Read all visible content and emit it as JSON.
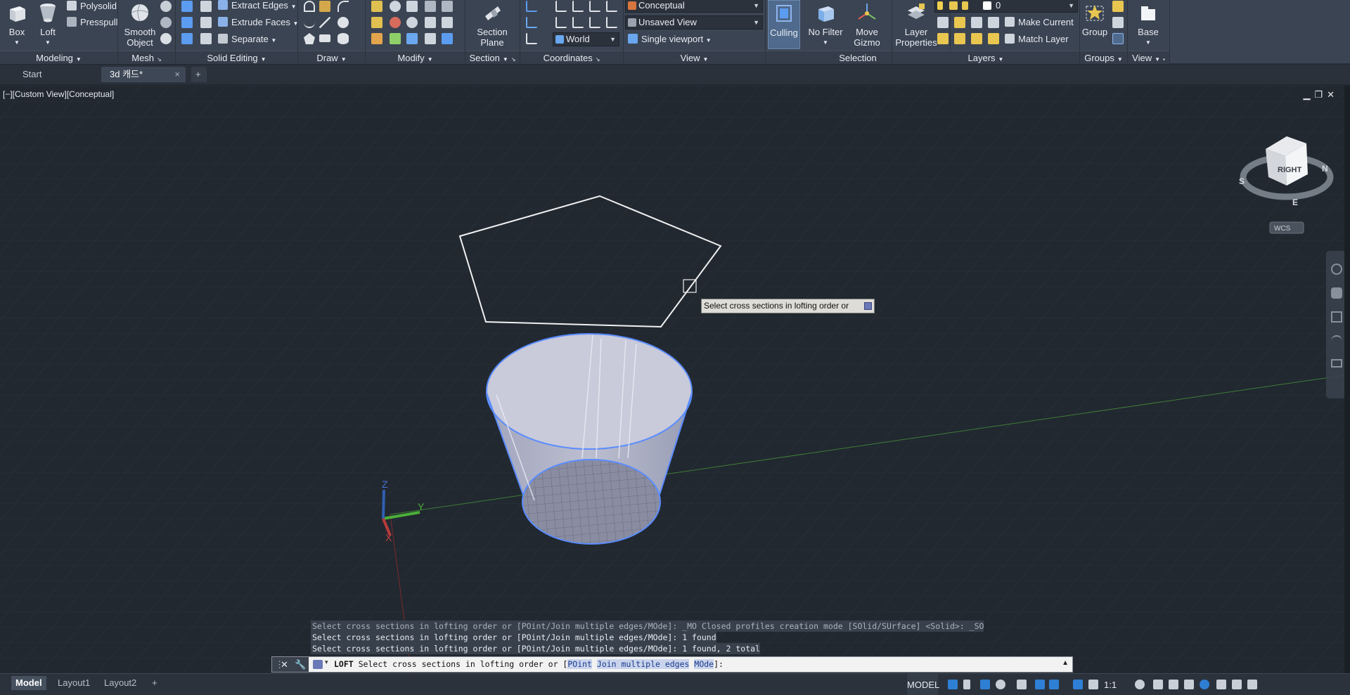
{
  "ribbon": {
    "modeling": {
      "title": "Modeling",
      "box": "Box",
      "loft": "Loft",
      "polysolid": "Polysolid",
      "presspull": "Presspull"
    },
    "mesh": {
      "title": "Mesh",
      "smooth_object": "Smooth Object"
    },
    "solid_editing": {
      "title": "Solid Editing",
      "extract_edges": "Extract Edges",
      "extrude_faces": "Extrude Faces",
      "separate": "Separate"
    },
    "draw": {
      "title": "Draw"
    },
    "modify": {
      "title": "Modify"
    },
    "section": {
      "title": "Section",
      "section_plane": "Section Plane"
    },
    "coordinates": {
      "title": "Coordinates",
      "world": "World"
    },
    "view": {
      "title": "View",
      "visual_style": "Conceptual",
      "named_view": "Unsaved View",
      "viewport": "Single viewport"
    },
    "selection": {
      "title": "Selection",
      "culling": "Culling",
      "no_filter": "No Filter",
      "move_gizmo": "Move Gizmo"
    },
    "layers": {
      "title": "Layers",
      "layer_properties": "Layer Properties",
      "current_layer": "0",
      "make_current": "Make Current",
      "match_layer": "Match Layer"
    },
    "groups": {
      "title": "Groups",
      "group": "Group"
    },
    "view2": {
      "title": "View",
      "base": "Base"
    }
  },
  "tabs": {
    "start": "Start",
    "doc": "3d 캐드*",
    "add": "+"
  },
  "viewport": {
    "label": "[−][Custom View][Conceptual]",
    "viewcube_face": "RIGHT",
    "compass_s": "S",
    "compass_n": "N",
    "compass_e": "E",
    "wcs": "WCS",
    "axis_x": "X",
    "axis_y": "Y",
    "axis_z": "Z"
  },
  "tooltip": {
    "text": "Select cross sections in lofting order or"
  },
  "command": {
    "history": [
      "Select cross sections in lofting order or [POint/Join multiple edges/MOde]: _MO Closed profiles creation mode [SOlid/SUrface] <Solid>: _SO",
      "Select cross sections in lofting order or [POint/Join multiple edges/MOde]: 1 found",
      "Select cross sections in lofting order or [POint/Join multiple edges/MOde]: 1 found, 2 total"
    ],
    "cmd_name": "LOFT",
    "prompt": " Select cross sections in lofting order or [",
    "opt1": "POint",
    "opt2": "Join multiple edges",
    "opt3": "MOde",
    "prompt_end": "]:"
  },
  "status": {
    "layouts": [
      "Model",
      "Layout1",
      "Layout2"
    ],
    "add_layout": "+",
    "model_space": "MODEL",
    "scale": "1:1"
  },
  "colors": {
    "ribbon_bg": "#3b4453",
    "viewport_bg": "#212830",
    "selection_blue": "#5a8cff",
    "accent_active": "#1e7bc9"
  }
}
